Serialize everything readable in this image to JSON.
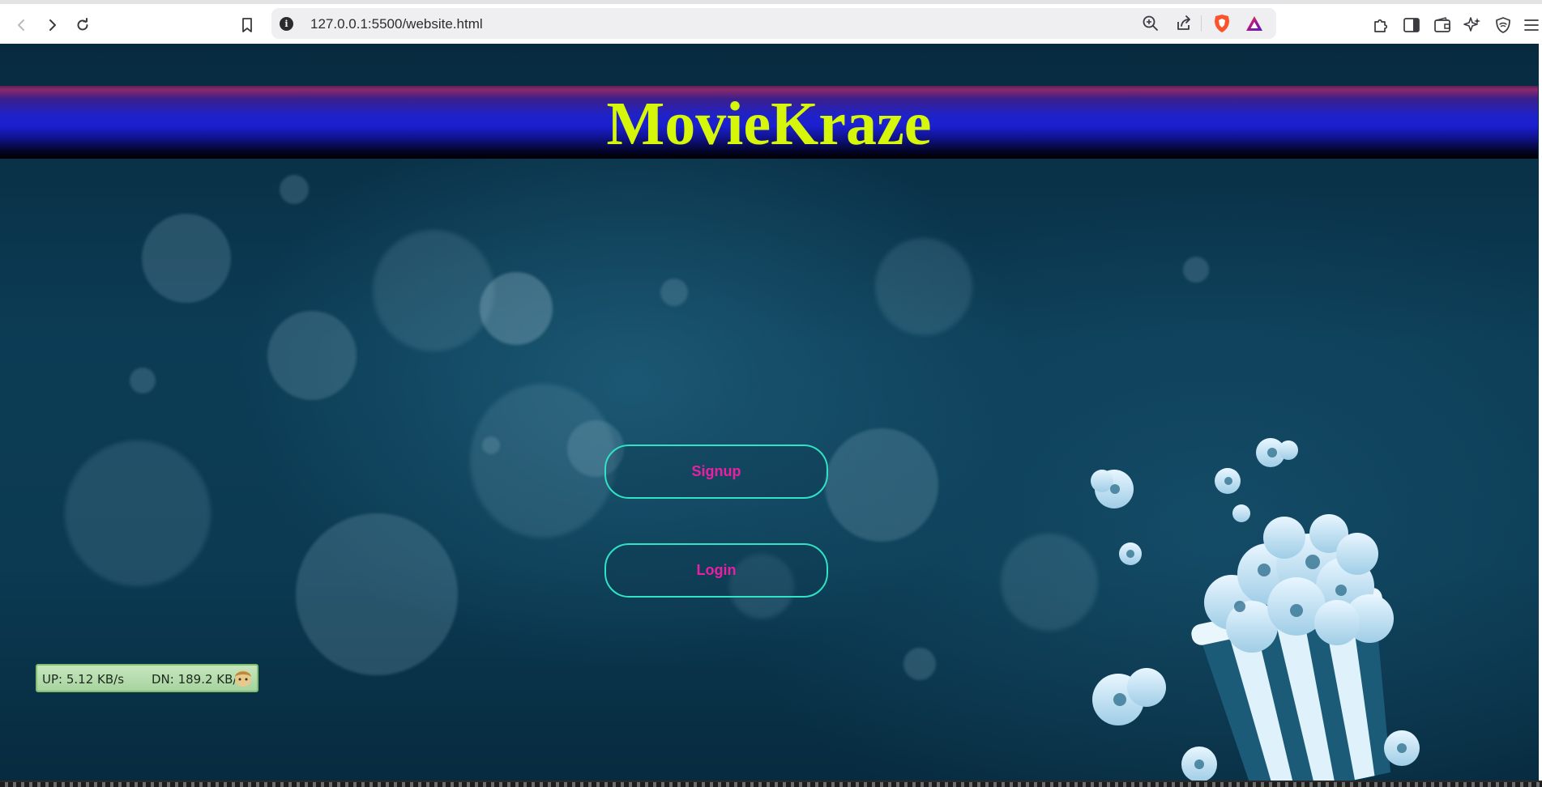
{
  "browser": {
    "url": "127.0.0.1:5500/website.html",
    "icons": [
      "back-icon",
      "forward-icon",
      "reload-icon",
      "bookmark-icon",
      "site-info-icon",
      "zoom-icon",
      "share-icon",
      "brave-shields-icon",
      "brave-rewards-icon",
      "extensions-icon",
      "sidebar-icon",
      "wallet-icon",
      "leo-ai-icon",
      "vpn-icon",
      "menu-icon"
    ]
  },
  "page": {
    "title": "MovieKraze",
    "signup_label": "Signup",
    "login_label": "Login"
  },
  "net_widget": {
    "up": "UP: 5.12 KB/s",
    "dn": "DN: 189.2 KB/s"
  },
  "colors": {
    "title": "#d6f70a",
    "button_border": "#2fe3c4",
    "button_text": "#ea1fa3",
    "banner_blue": "#1b1fd0"
  }
}
